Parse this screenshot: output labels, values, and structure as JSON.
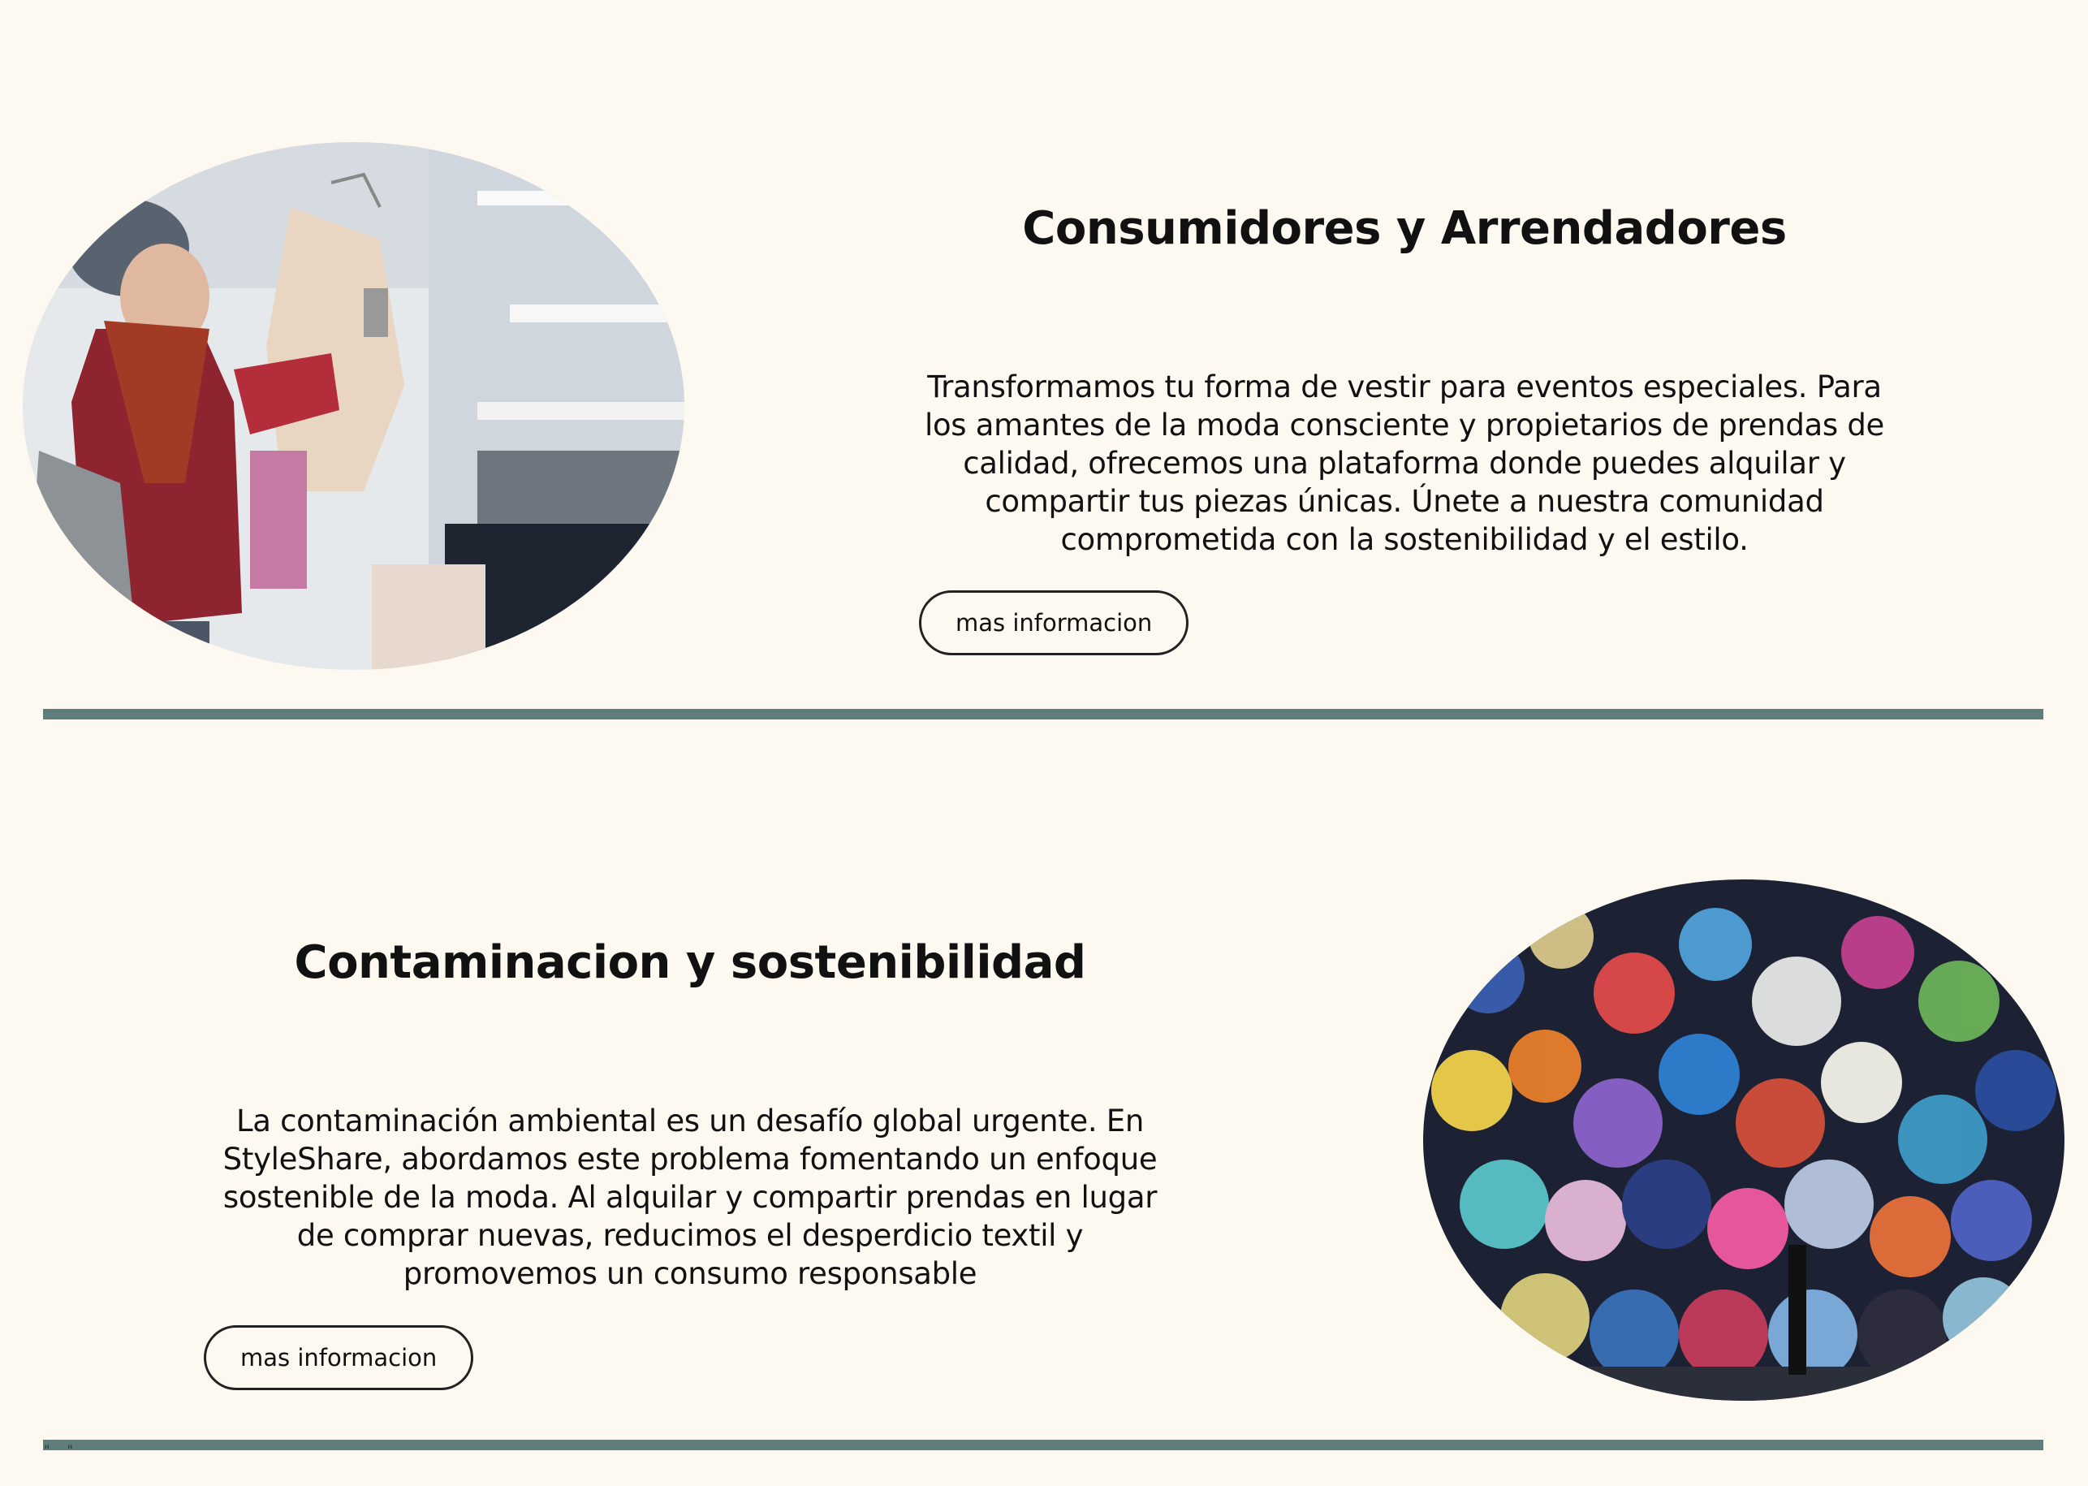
{
  "section_one": {
    "title": "Consumidores y Arrendadores",
    "body": "Transformamos tu forma de vestir para eventos especiales. Para los amantes de la moda consciente y propietarios de prendas de calidad, ofrecemos una plataforma donde puedes alquilar y compartir tus piezas únicas. Únete a nuestra comunidad comprometida con la sostenibilidad y el estilo.",
    "button_label": "mas informacion"
  },
  "section_two": {
    "title": "Contaminacion y sostenibilidad",
    "body": "La contaminación ambiental es un desafío global urgente. En StyleShare, abordamos este problema fomentando un enfoque sostenible de la moda. Al alquilar y compartir prendas en lugar de comprar nuevas, reducimos el desperdicio textil y promovemos un consumo responsable",
    "button_label": "mas informacion"
  },
  "footer": {
    "stray_text": "\" \""
  },
  "colors": {
    "background": "#fdf9f1",
    "divider": "#5f7d7b",
    "text": "#111111"
  }
}
